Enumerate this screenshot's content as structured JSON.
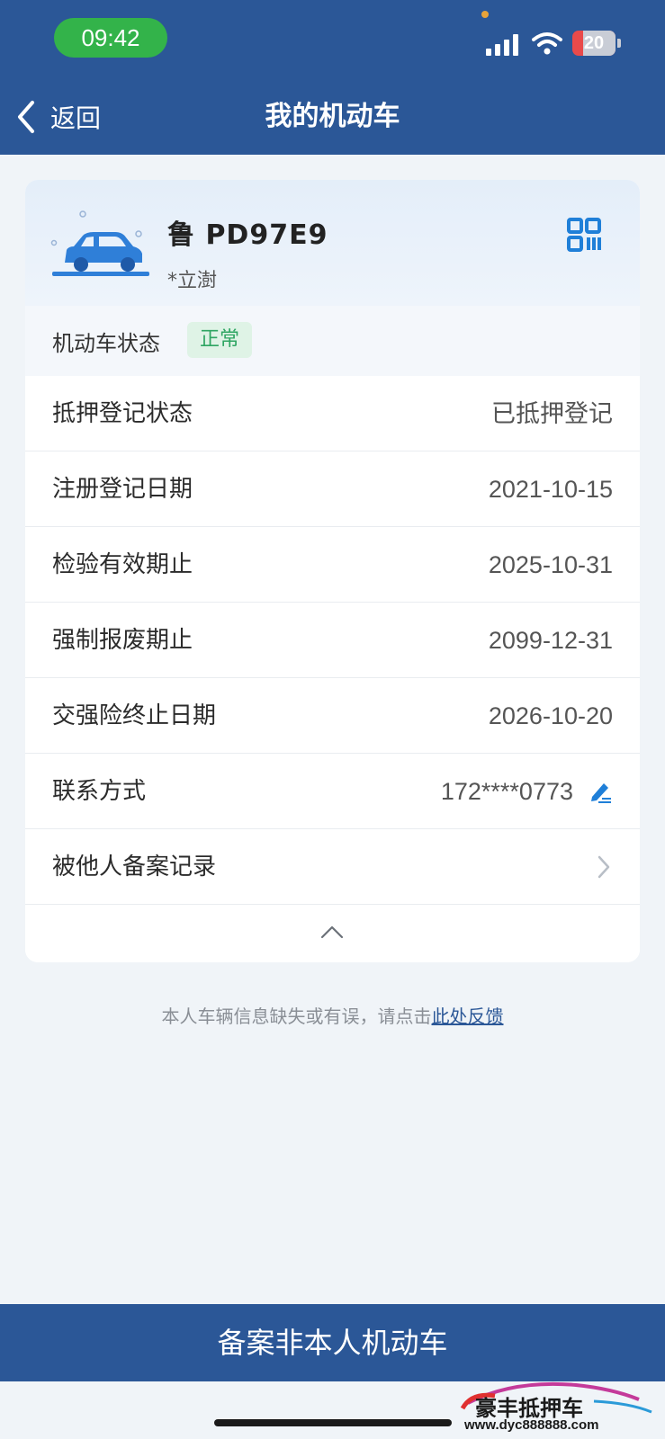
{
  "status_bar": {
    "time": "09:42",
    "battery": "20"
  },
  "nav": {
    "back_label": "返回",
    "title": "我的机动车"
  },
  "vehicle": {
    "plate": "鲁 PD97E9",
    "owner": "*立澍",
    "status_label": "机动车状态",
    "status_value": "正常"
  },
  "details": [
    {
      "label": "抵押登记状态",
      "value": "已抵押登记"
    },
    {
      "label": "注册登记日期",
      "value": "2021-10-15"
    },
    {
      "label": "检验有效期止",
      "value": "2025-10-31"
    },
    {
      "label": "强制报废期止",
      "value": "2099-12-31"
    },
    {
      "label": "交强险终止日期",
      "value": "2026-10-20"
    },
    {
      "label": "联系方式",
      "value": "172****0773"
    },
    {
      "label": "被他人备案记录",
      "value": ""
    }
  ],
  "feedback": {
    "text": "本人车辆信息缺失或有误，请点击",
    "link": "此处反馈"
  },
  "bottom_button": "备案非本人机动车",
  "watermark": {
    "brand": "豪丰抵押车",
    "url": "www.dyc888888.com"
  },
  "colors": {
    "primary": "#2b5797",
    "status_green": "#2ea562",
    "time_pill": "#33b34a"
  }
}
